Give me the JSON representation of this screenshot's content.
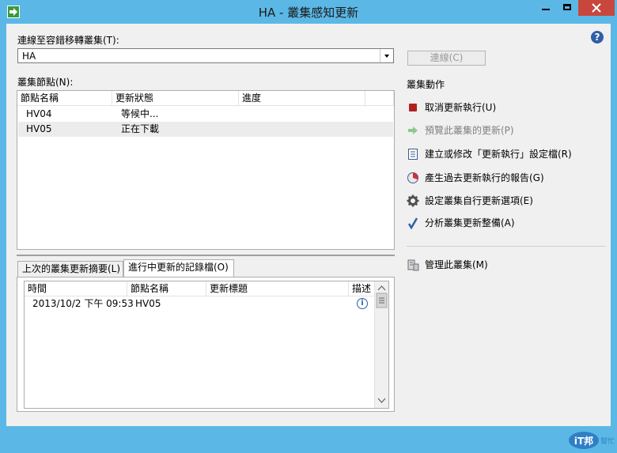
{
  "window": {
    "title": "HA - 叢集感知更新"
  },
  "connect": {
    "label": "連線至容錯移轉叢集(T):",
    "value": "HA",
    "button": "連線(C)"
  },
  "nodes": {
    "label": "叢集節點(N):",
    "columns": [
      "節點名稱",
      "更新狀態",
      "進度"
    ],
    "rows": [
      {
        "name": "HV04",
        "status": "等候中..."
      },
      {
        "name": "HV05",
        "status": "正在下載"
      }
    ]
  },
  "tabs": [
    "上次的叢集更新摘要(L)",
    "進行中更新的記錄檔(O)"
  ],
  "log": {
    "columns": [
      "時間",
      "節點名稱",
      "更新標題",
      "描述"
    ],
    "rows": [
      {
        "time": "2013/10/2 下午 09:53",
        "node": "HV05"
      }
    ]
  },
  "actions": {
    "title": "叢集動作",
    "items": [
      {
        "label": "取消更新執行(U)",
        "icon": "stop-icon",
        "enabled": true
      },
      {
        "label": "預覽此叢集的更新(P)",
        "icon": "arrow-right-icon",
        "enabled": false
      },
      {
        "label": "建立或修改「更新執行」設定檔(R)",
        "icon": "document-icon",
        "enabled": true
      },
      {
        "label": "產生過去更新執行的報告(G)",
        "icon": "report-icon",
        "enabled": true
      },
      {
        "label": "設定叢集自行更新選項(E)",
        "icon": "gear-icon",
        "enabled": true
      },
      {
        "label": "分析叢集更新整備(A)",
        "icon": "checkmark-icon",
        "enabled": true
      }
    ],
    "manage": {
      "label": "管理此叢集(M)",
      "icon": "server-icon"
    }
  },
  "watermark": {
    "text": "iT邦",
    "sub": "幫忙"
  },
  "colors": {
    "titlebar": "#5bb8e6",
    "close": "#c9463d",
    "accent": "#2f5fa6"
  }
}
